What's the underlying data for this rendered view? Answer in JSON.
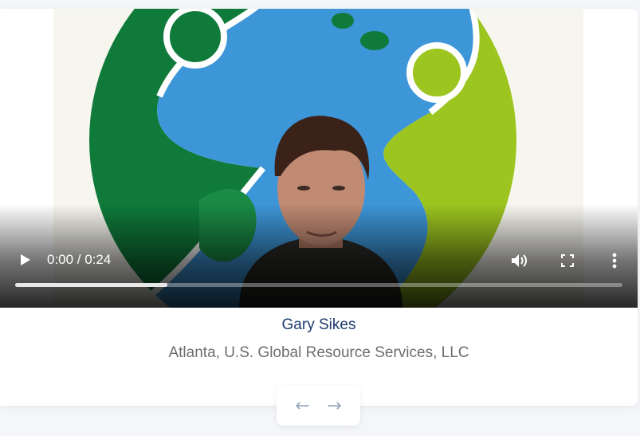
{
  "video": {
    "time_display": "0:00 / 0:24",
    "progress_fraction": 0.25
  },
  "testimonial": {
    "name": "Gary Sikes",
    "company": "Atlanta, U.S. Global Resource Services, LLC"
  },
  "navigation": {
    "prev_symbol": "←",
    "next_symbol": "→"
  },
  "icons": {
    "play": "play-icon",
    "volume": "volume-icon",
    "fullscreen": "fullscreen-icon",
    "more": "more-vertical-icon",
    "prev": "arrow-left-icon",
    "next": "arrow-right-icon"
  },
  "colors": {
    "name_text": "#1b3a6b",
    "company_text": "#6b6e72",
    "nav_arrow": "#9aa8bf"
  }
}
